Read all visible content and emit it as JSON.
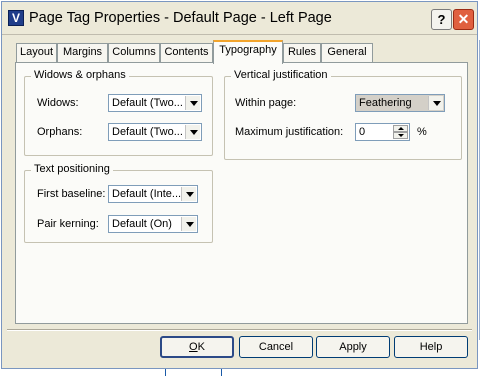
{
  "window": {
    "title": "Page Tag Properties - Default Page - Left Page",
    "app_icon_letter": "V",
    "help_glyph": "?",
    "close_glyph": "✕"
  },
  "tabs": [
    {
      "label": "Layout",
      "active": false
    },
    {
      "label": "Margins",
      "active": false
    },
    {
      "label": "Columns",
      "active": false
    },
    {
      "label": "Contents",
      "active": false
    },
    {
      "label": "Typography",
      "active": true
    },
    {
      "label": "Rules",
      "active": false
    },
    {
      "label": "General",
      "active": false
    }
  ],
  "widows_orphans": {
    "legend": "Widows & orphans",
    "widows_label": "Widows:",
    "widows_value": "Default (Two...",
    "orphans_label": "Orphans:",
    "orphans_value": "Default (Two..."
  },
  "text_positioning": {
    "legend": "Text positioning",
    "first_baseline_label": "First baseline:",
    "first_baseline_value": "Default (Inte...",
    "pair_kerning_label": "Pair kerning:",
    "pair_kerning_value": "Default (On)"
  },
  "vertical_justification": {
    "legend": "Vertical justification",
    "within_page_label": "Within page:",
    "within_page_value": "Feathering",
    "max_label": "Maximum justification:",
    "max_value": "0",
    "unit": "%"
  },
  "buttons": {
    "ok_underlined": "O",
    "ok_rest": "K",
    "cancel": "Cancel",
    "apply": "Apply",
    "help": "Help"
  },
  "colors": {
    "close_button": "#e0603f",
    "active_tab_accent": "#f2a42c",
    "dialog_face": "#ece9d8"
  }
}
